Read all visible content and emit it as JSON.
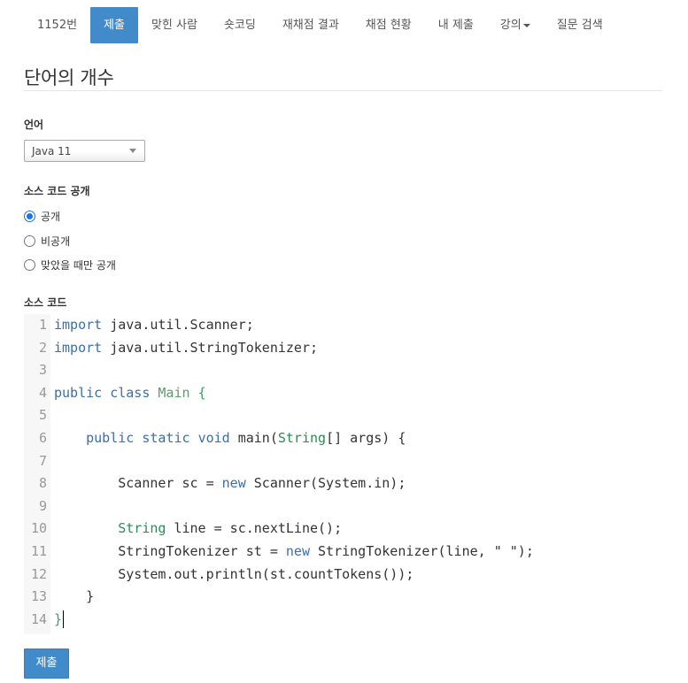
{
  "nav": {
    "items": [
      {
        "label": "1152번"
      },
      {
        "label": "제출"
      },
      {
        "label": "맞힌 사람"
      },
      {
        "label": "숏코딩"
      },
      {
        "label": "재채점 결과"
      },
      {
        "label": "채점 현황"
      },
      {
        "label": "내 제출"
      },
      {
        "label": "강의"
      },
      {
        "label": "질문 검색"
      }
    ],
    "active_index": 1
  },
  "page": {
    "title": "단어의 개수"
  },
  "language": {
    "label": "언어",
    "selected": "Java 11"
  },
  "visibility": {
    "label": "소스 코드 공개",
    "options": [
      {
        "label": "공개",
        "checked": true
      },
      {
        "label": "비공개",
        "checked": false
      },
      {
        "label": "맞았을 때만 공개",
        "checked": false
      }
    ]
  },
  "source": {
    "label": "소스 코드",
    "lines": [
      {
        "n": "1",
        "tokens": [
          {
            "t": "import",
            "c": "kw"
          },
          {
            "t": " java.util.Scanner;"
          }
        ]
      },
      {
        "n": "2",
        "tokens": [
          {
            "t": "import",
            "c": "kw"
          },
          {
            "t": " java.util.StringTokenizer;"
          }
        ]
      },
      {
        "n": "3",
        "tokens": []
      },
      {
        "n": "4",
        "tokens": [
          {
            "t": "public",
            "c": "kw"
          },
          {
            "t": " "
          },
          {
            "t": "class",
            "c": "kw"
          },
          {
            "t": " "
          },
          {
            "t": "Main",
            "c": "cls"
          },
          {
            "t": " "
          },
          {
            "t": "{",
            "c": "br"
          }
        ]
      },
      {
        "n": "5",
        "tokens": []
      },
      {
        "n": "6",
        "tokens": [
          {
            "t": "    "
          },
          {
            "t": "public",
            "c": "kw"
          },
          {
            "t": " "
          },
          {
            "t": "static",
            "c": "kw"
          },
          {
            "t": " "
          },
          {
            "t": "void",
            "c": "kw"
          },
          {
            "t": " main("
          },
          {
            "t": "String",
            "c": "ty"
          },
          {
            "t": "[] args) {"
          }
        ]
      },
      {
        "n": "7",
        "tokens": []
      },
      {
        "n": "8",
        "tokens": [
          {
            "t": "        Scanner sc = "
          },
          {
            "t": "new",
            "c": "kw"
          },
          {
            "t": " Scanner(System.in);"
          }
        ]
      },
      {
        "n": "9",
        "tokens": []
      },
      {
        "n": "10",
        "tokens": [
          {
            "t": "        "
          },
          {
            "t": "String",
            "c": "ty"
          },
          {
            "t": " line = sc.nextLine();"
          }
        ]
      },
      {
        "n": "11",
        "tokens": [
          {
            "t": "        StringTokenizer st = "
          },
          {
            "t": "new",
            "c": "kw"
          },
          {
            "t": " StringTokenizer(line, \" \");"
          }
        ]
      },
      {
        "n": "12",
        "tokens": [
          {
            "t": "        System.out.println(st.countTokens());"
          }
        ]
      },
      {
        "n": "13",
        "tokens": [
          {
            "t": "    }"
          }
        ]
      },
      {
        "n": "14",
        "tokens": [
          {
            "t": "}",
            "c": "br"
          }
        ],
        "cursor": true
      }
    ]
  },
  "submit": {
    "label": "제출"
  },
  "colors": {
    "accent": "#428bca",
    "keyword": "#3a6fa8",
    "type": "#2e8b57"
  }
}
